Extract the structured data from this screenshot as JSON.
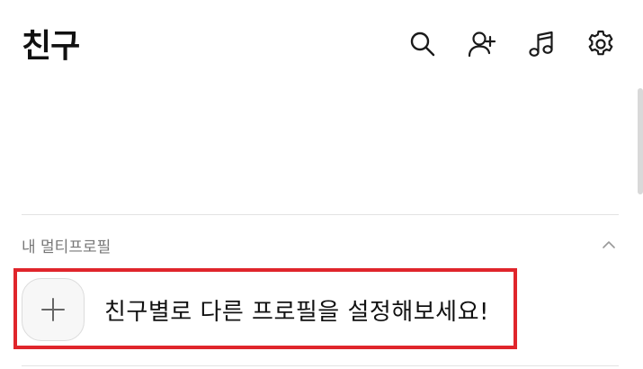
{
  "header": {
    "title": "친구",
    "icons": [
      "search-icon",
      "add-friend-icon",
      "music-icon",
      "settings-icon"
    ]
  },
  "multi_profile": {
    "section_label": "내 멀티프로필",
    "cta_text": "친구별로 다른 프로필을 설정해보세요!"
  },
  "colors": {
    "highlight_border": "#e0252b",
    "text_primary": "#111111",
    "text_secondary": "#777777",
    "divider": "#e3e3e3"
  }
}
